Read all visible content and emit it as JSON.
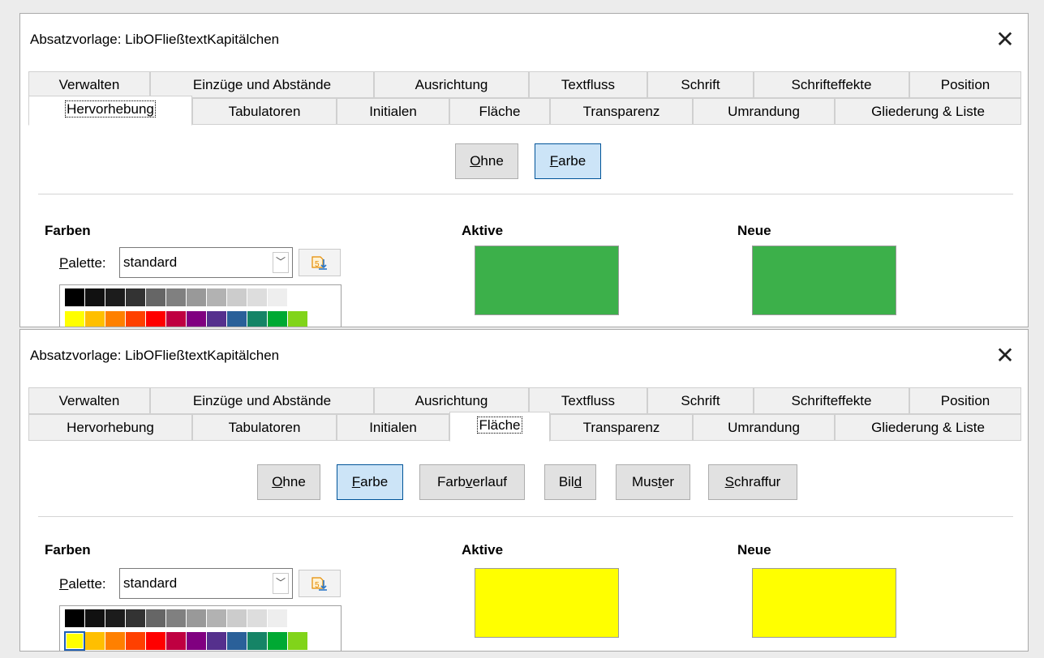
{
  "dialogs": [
    {
      "title": "Absatzvorlage: LibOFließtextKapitälchen",
      "tabs_row1": [
        "Verwalten",
        "Einzüge und Abstände",
        "Ausrichtung",
        "Textfluss",
        "Schrift",
        "Schrifteffekte",
        "Position"
      ],
      "tabs_row2": [
        "Hervorhebung",
        "Tabulatoren",
        "Initialen",
        "Fläche",
        "Transparenz",
        "Umrandung",
        "Gliederung & Liste"
      ],
      "active_tab": "Hervorhebung",
      "buttons": [
        "Ohne",
        "Farbe"
      ],
      "selected_button": "Farbe",
      "farben_label": "Farben",
      "palette_label": "Palette:",
      "palette_value": "standard",
      "aktive_label": "Aktive",
      "neue_label": "Neue",
      "aktive_color": "#3cb04a",
      "neue_color": "#3cb04a"
    },
    {
      "title": "Absatzvorlage: LibOFließtextKapitälchen",
      "tabs_row1": [
        "Verwalten",
        "Einzüge und Abstände",
        "Ausrichtung",
        "Textfluss",
        "Schrift",
        "Schrifteffekte",
        "Position"
      ],
      "tabs_row2": [
        "Hervorhebung",
        "Tabulatoren",
        "Initialen",
        "Fläche",
        "Transparenz",
        "Umrandung",
        "Gliederung & Liste"
      ],
      "active_tab": "Fläche",
      "buttons": [
        "Ohne",
        "Farbe",
        "Farbverlauf",
        "Bild",
        "Muster",
        "Schraffur"
      ],
      "selected_button": "Farbe",
      "farben_label": "Farben",
      "palette_label": "Palette:",
      "palette_value": "standard",
      "aktive_label": "Aktive",
      "neue_label": "Neue",
      "aktive_color": "#ffff00",
      "neue_color": "#ffff00"
    }
  ],
  "swatch_colors": {
    "row1": [
      "#000000",
      "#111111",
      "#1c1c1c",
      "#333333",
      "#666666",
      "#808080",
      "#999999",
      "#b2b2b2",
      "#cccccc",
      "#dddddd",
      "#eeeeee",
      "#ffffff"
    ],
    "row2": [
      "#ffff00",
      "#ffbf00",
      "#ff8000",
      "#ff4000",
      "#ff0000",
      "#bf0041",
      "#800080",
      "#55308d",
      "#2a6099",
      "#158466",
      "#00a933",
      "#81d41a"
    ]
  },
  "icons": {
    "close": "close-icon",
    "dropdown": "chevron-down-icon",
    "add_palette": "add-palette-icon"
  }
}
